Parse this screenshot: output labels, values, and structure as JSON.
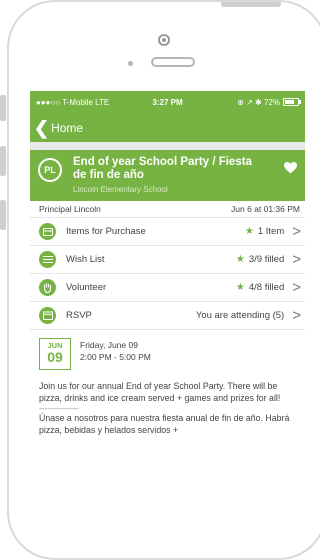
{
  "status_bar": {
    "carrier": "●●●○○ T-Mobile  LTE",
    "time": "3:27 PM",
    "indicators": "⊕ ↗ ✱ 72%"
  },
  "nav": {
    "back_label": "Home"
  },
  "event": {
    "avatar_initials": "PL",
    "title": "End of year School Party / Fiesta de fin de año",
    "school": "Lincoln Elementary School",
    "organizer": "Principal Lincoln",
    "posted": "Jun 6 at 01:36 PM"
  },
  "rows": [
    {
      "label": "Items for Purchase",
      "value": "1 Item",
      "icon": "purchase-icon",
      "star": true
    },
    {
      "label": "Wish List",
      "value": "3/9 filled",
      "icon": "wish-list-icon",
      "star": true
    },
    {
      "label": "Volunteer",
      "value": "4/8 filled",
      "icon": "volunteer-hand-icon",
      "star": true
    },
    {
      "label": "RSVP",
      "value": "You are attending (5)",
      "icon": "calendar-icon",
      "star": false
    }
  ],
  "date": {
    "month": "JUN",
    "day": "09",
    "weekday_line": "Friday, June 09",
    "time_range": "2:00 PM - 5:00 PM"
  },
  "description": {
    "english": "Join us for our annual End of year School Party. There will be pizza, drinks and ice cream served + games and prizes for all!",
    "divider": "---------------",
    "spanish": "Únase a nosotros para nuestra fiesta anual de fin de año. Habrá pizza, bebidas y helados servidos +"
  },
  "colors": {
    "accent": "#77b343"
  }
}
